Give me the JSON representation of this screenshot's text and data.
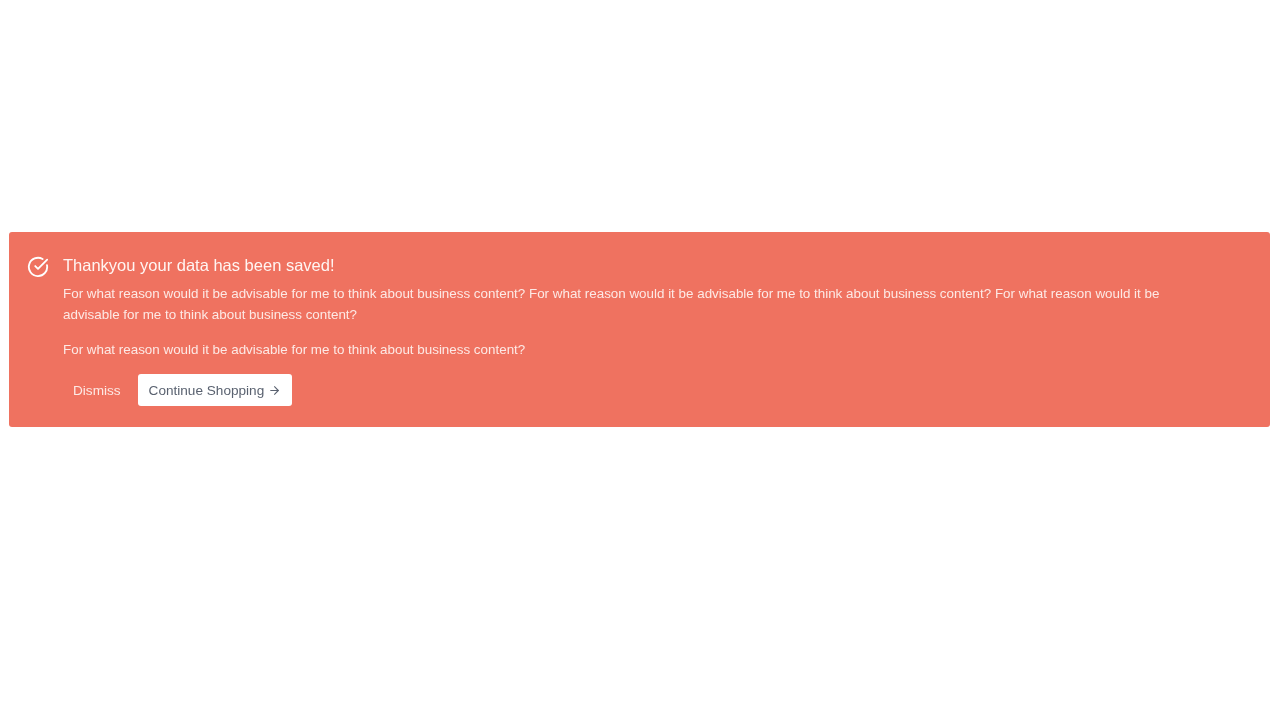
{
  "alert": {
    "title": "Thankyou your data has been saved!",
    "paragraphs": [
      "For what reason would it be advisable for me to think about business content? For what reason would it be advisable for me to think about business content? For what reason would it be advisable for me to think about business content?",
      "For what reason would it be advisable for me to think about business content?"
    ],
    "buttons": [
      {
        "label": "Dismiss",
        "kind": "text"
      },
      {
        "label": "Continue Shopping",
        "kind": "solid"
      }
    ]
  }
}
